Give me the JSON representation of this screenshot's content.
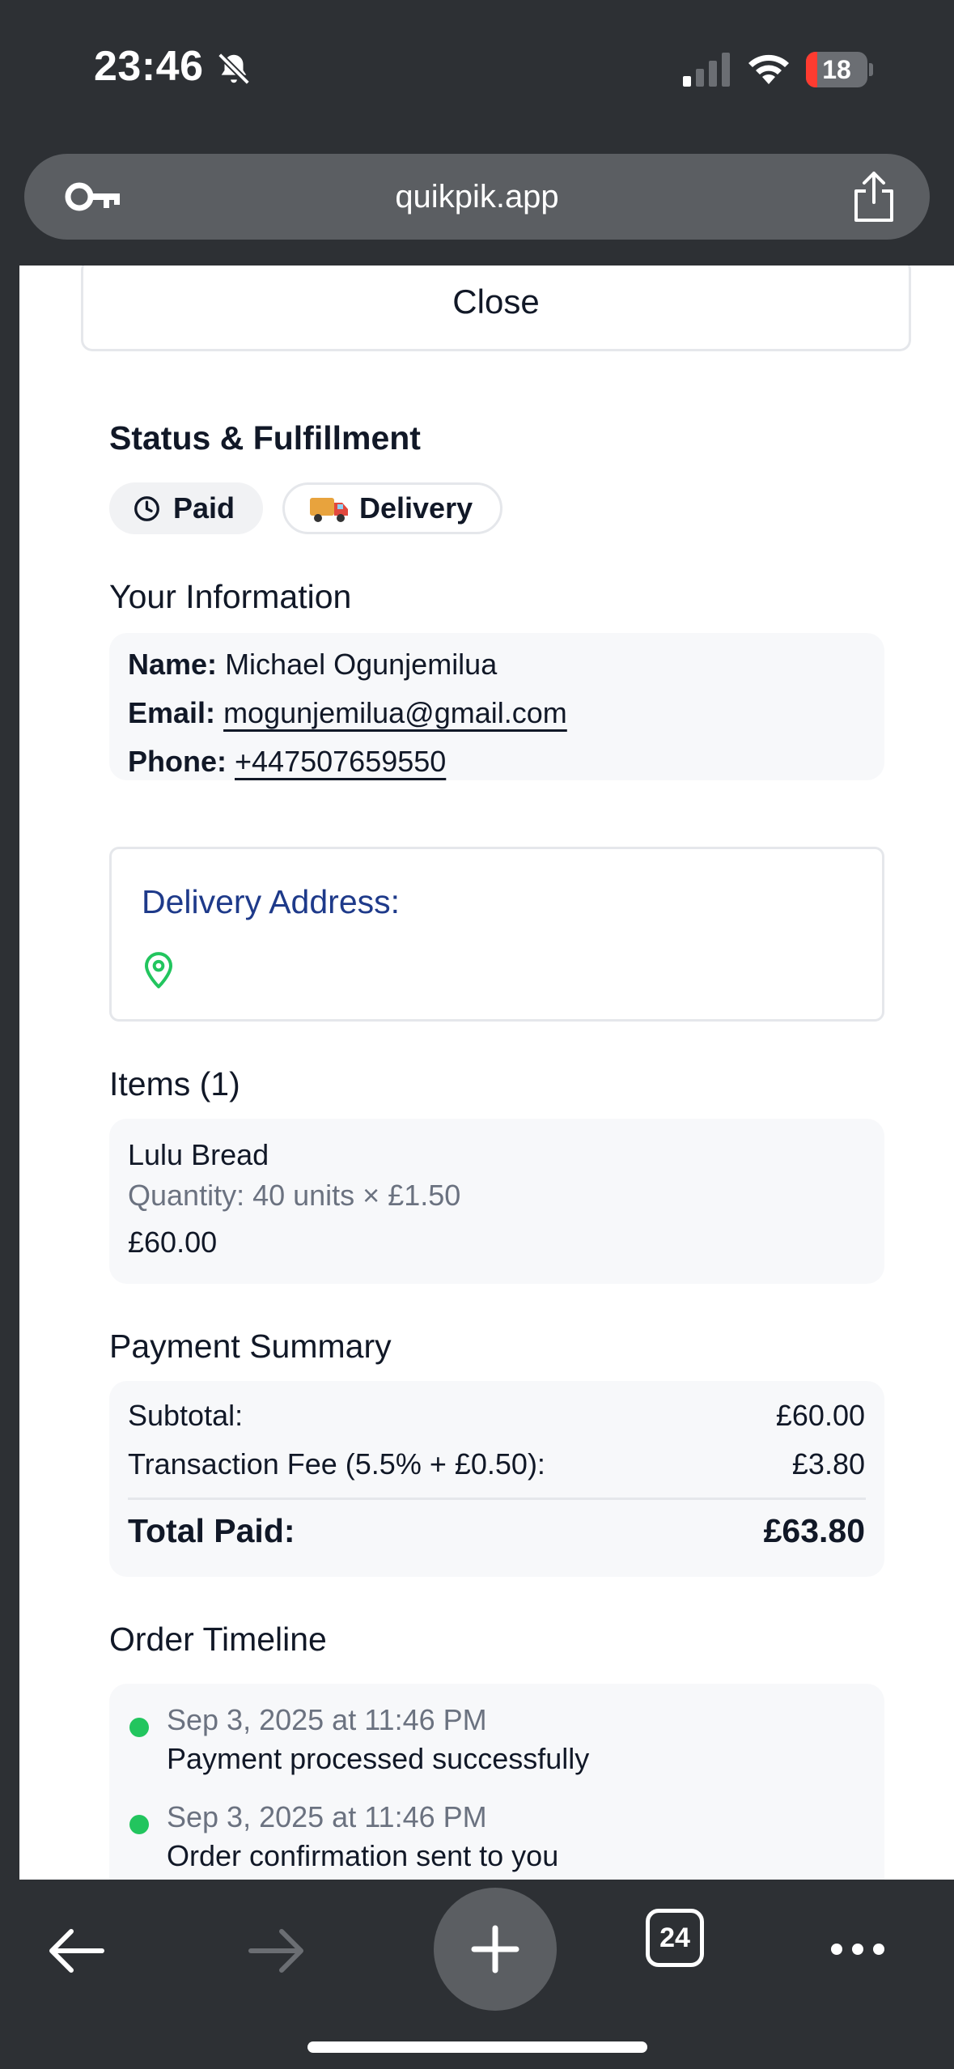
{
  "status_bar": {
    "time": "23:46",
    "battery_level": "18",
    "battery_fraction": 0.18,
    "battery_color": "#ff3b30"
  },
  "browser": {
    "url": "quikpik.app",
    "tab_count": "24",
    "icons": [
      "key-icon",
      "share-icon",
      "back-arrow-icon",
      "forward-arrow-icon",
      "plus-icon",
      "tabs-icon",
      "more-icon"
    ]
  },
  "page": {
    "close_label": "Close",
    "status_heading": "Status & Fulfillment",
    "payment_badge": "Paid",
    "fulfillment_badge": "Delivery",
    "info_heading": "Your Information",
    "info": {
      "name_label": "Name:",
      "name": "Michael Ogunjemilua",
      "email_label": "Email:",
      "email": "mogunjemilua@gmail.com",
      "phone_label": "Phone:",
      "phone": "+447507659550"
    },
    "delivery_address_label": "Delivery Address:",
    "items_heading": "Items (1)",
    "items": [
      {
        "name": "Lulu Bread",
        "quantity_text": "Quantity: 40 units × £1.50",
        "total": "£60.00"
      }
    ],
    "payment_heading": "Payment Summary",
    "payment": {
      "subtotal_label": "Subtotal:",
      "subtotal": "£60.00",
      "fee_label": "Transaction Fee (5.5% + £0.50):",
      "fee": "£3.80",
      "total_label": "Total Paid:",
      "total": "£63.80"
    },
    "timeline_heading": "Order Timeline",
    "timeline": [
      {
        "date": "Sep 3, 2025 at 11:46 PM",
        "event": "Payment processed successfully"
      },
      {
        "date": "Sep 3, 2025 at 11:46 PM",
        "event": "Order confirmation sent to you"
      }
    ]
  },
  "colors": {
    "accent_link": "#1e3a8a",
    "success": "#22c55e",
    "chrome": "#2d3034"
  }
}
